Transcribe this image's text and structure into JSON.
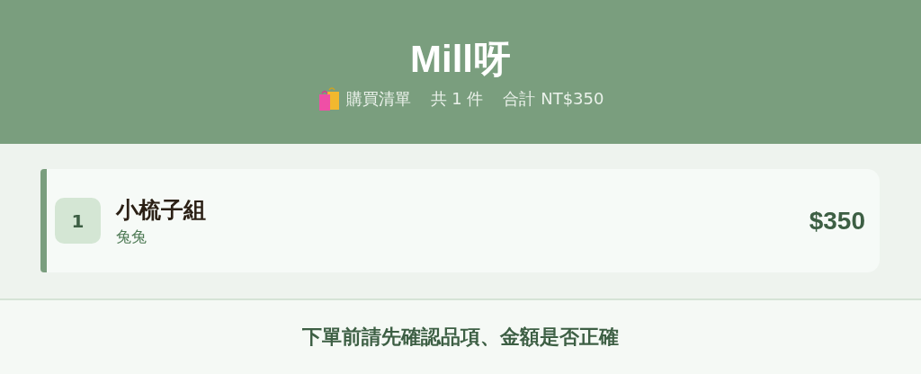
{
  "header": {
    "title": "Mill呀",
    "list_label": "購買清單",
    "count": "共 1 件",
    "total": "合計 NT$350"
  },
  "items": [
    {
      "index": "1",
      "name": "小梳子組",
      "variant": "兔兔",
      "price": "$350"
    }
  ],
  "footer": {
    "notice": "下單前請先確認品項、金額是否正確"
  }
}
